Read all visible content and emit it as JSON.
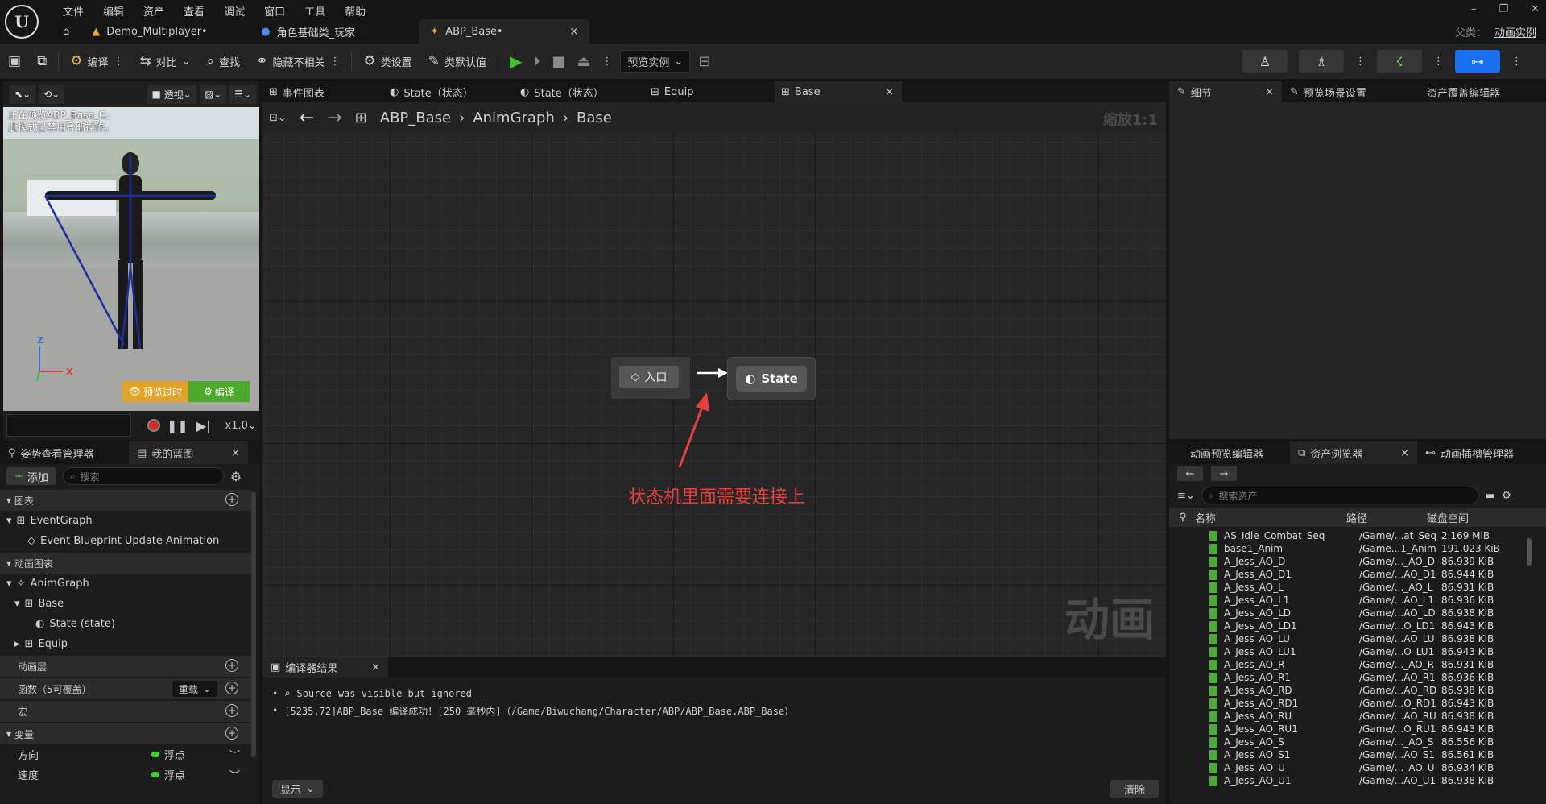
{
  "menus": [
    "文件",
    "编辑",
    "资产",
    "查看",
    "调试",
    "窗口",
    "工具",
    "帮助"
  ],
  "doc_tabs": [
    {
      "label": "Demo_Multiplayer•"
    },
    {
      "label": "角色基础类_玩家"
    },
    {
      "label": "ABP_Base•"
    }
  ],
  "parent_class": {
    "label": "父类：",
    "value": "动画实例"
  },
  "toolbar": {
    "compile": "编译",
    "diff": "对比",
    "find": "查找",
    "hide_unrelated": "隐藏不相关",
    "class_settings": "类设置",
    "class_defaults": "类默认值",
    "preview_instance": "预览实例"
  },
  "viewport": {
    "perspective": "透视",
    "message_line1": "正在预览ABP_Base_C。",
    "message_line2": "此模式已禁用骨骼操作。",
    "preview_btn": "预览过时",
    "compile_btn": "编译",
    "axis_z": "Z",
    "axis_x": "X",
    "speed": "x1.0"
  },
  "left_panel": {
    "tabs": [
      {
        "label": "姿势查看管理器"
      },
      {
        "label": "我的蓝图"
      }
    ],
    "add": "添加",
    "search_placeholder": "搜索",
    "graphs_section": "图表",
    "event_graph": "EventGraph",
    "event_update": "Event Blueprint Update Animation",
    "anim_graphs_section": "动画图表",
    "anim_graph": "AnimGraph",
    "base": "Base",
    "state": "State (state)",
    "equip": "Equip",
    "anim_layers": "动画层",
    "functions": "函数（5可覆盖）",
    "override": "重载",
    "macros": "宏",
    "variables": "变量",
    "vars": [
      {
        "name": "方向",
        "type": "浮点"
      },
      {
        "name": "速度",
        "type": "浮点"
      }
    ]
  },
  "graph_tabs": [
    {
      "label": "事件图表"
    },
    {
      "label": "State（状态）"
    },
    {
      "label": "State（状态）"
    },
    {
      "label": "Equip"
    },
    {
      "label": "Base"
    }
  ],
  "breadcrumb": {
    "root": "ABP_Base",
    "mid": "AnimGraph",
    "leaf": "Base",
    "zoom": "缩放1:1"
  },
  "graph": {
    "entry_label": "入口",
    "state_label": "State",
    "annotation": "状态机里面需要连接上",
    "watermark": "动画"
  },
  "compiler": {
    "tab": "编译器结果",
    "line1_link": "Source",
    "line1_rest": "was visible but ignored",
    "line2": "[5235.72]ABP_Base 编译成功！[250 毫秒内]（/Game/Biwuchang/Character/ABP/ABP_Base.ABP_Base）",
    "show": "显示",
    "clear": "清除"
  },
  "right_tabs": [
    {
      "label": "细节"
    },
    {
      "label": "预览场景设置"
    },
    {
      "label": "资产覆盖编辑器"
    }
  ],
  "browser": {
    "tabs": [
      {
        "label": "动画预览编辑器"
      },
      {
        "label": "资产浏览器"
      },
      {
        "label": "动画插槽管理器"
      }
    ],
    "search_placeholder": "搜索资产",
    "col_name": "名称",
    "col_path": "路径",
    "col_size": "磁盘空间",
    "assets": [
      {
        "name": "AS_Idle_Combat_Seq",
        "path": "/Game/...at_Seq",
        "size": "2.169 MiB"
      },
      {
        "name": "base1_Anim",
        "path": "/Game...1_Anim",
        "size": "191.023 KiB"
      },
      {
        "name": "A_Jess_AO_D",
        "path": "/Game/..._AO_D",
        "size": "86.939 KiB"
      },
      {
        "name": "A_Jess_AO_D1",
        "path": "/Game/...AO_D1",
        "size": "86.944 KiB"
      },
      {
        "name": "A_Jess_AO_L",
        "path": "/Game/..._AO_L",
        "size": "86.931 KiB"
      },
      {
        "name": "A_Jess_AO_L1",
        "path": "/Game/...AO_L1",
        "size": "86.936 KiB"
      },
      {
        "name": "A_Jess_AO_LD",
        "path": "/Game/...AO_LD",
        "size": "86.938 KiB"
      },
      {
        "name": "A_Jess_AO_LD1",
        "path": "/Game/...O_LD1",
        "size": "86.943 KiB"
      },
      {
        "name": "A_Jess_AO_LU",
        "path": "/Game/...AO_LU",
        "size": "86.938 KiB"
      },
      {
        "name": "A_Jess_AO_LU1",
        "path": "/Game/...O_LU1",
        "size": "86.943 KiB"
      },
      {
        "name": "A_Jess_AO_R",
        "path": "/Game/..._AO_R",
        "size": "86.931 KiB"
      },
      {
        "name": "A_Jess_AO_R1",
        "path": "/Game/...AO_R1",
        "size": "86.936 KiB"
      },
      {
        "name": "A_Jess_AO_RD",
        "path": "/Game/...AO_RD",
        "size": "86.938 KiB"
      },
      {
        "name": "A_Jess_AO_RD1",
        "path": "/Game/...O_RD1",
        "size": "86.943 KiB"
      },
      {
        "name": "A_Jess_AO_RU",
        "path": "/Game/...AO_RU",
        "size": "86.938 KiB"
      },
      {
        "name": "A_Jess_AO_RU1",
        "path": "/Game/...O_RU1",
        "size": "86.943 KiB"
      },
      {
        "name": "A_Jess_AO_S",
        "path": "/Game/..._AO_S",
        "size": "86.556 KiB"
      },
      {
        "name": "A_Jess_AO_S1",
        "path": "/Game/...AO_S1",
        "size": "86.561 KiB"
      },
      {
        "name": "A_Jess_AO_U",
        "path": "/Game/..._AO_U",
        "size": "86.934 KiB"
      },
      {
        "name": "A_Jess_AO_U1",
        "path": "/Game/...AO_U1",
        "size": "86.938 KiB"
      }
    ]
  }
}
